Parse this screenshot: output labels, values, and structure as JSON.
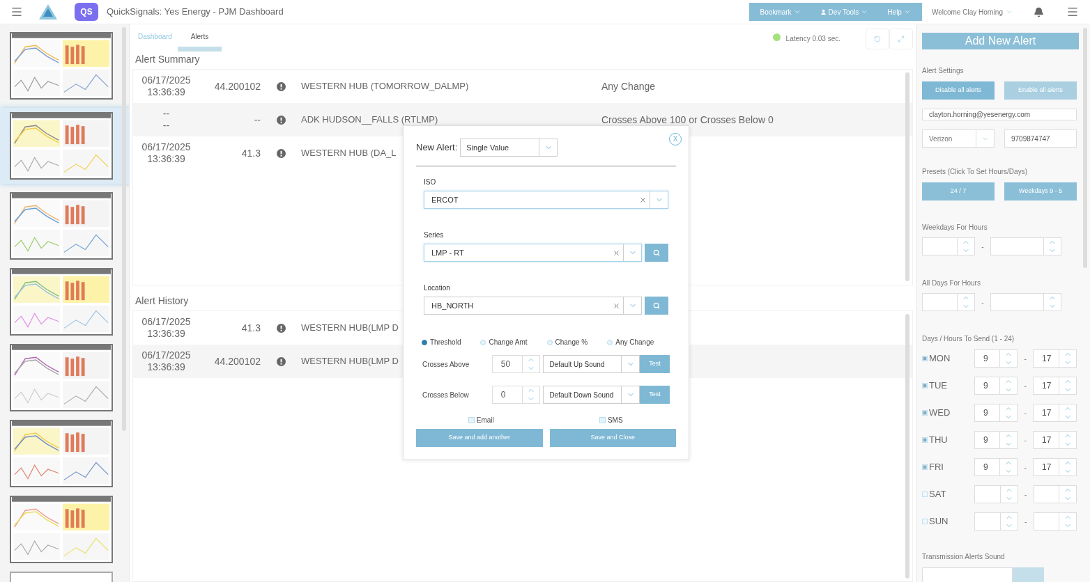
{
  "header": {
    "badge": "QS",
    "title": "QuickSignals: Yes Energy - PJM Dashboard",
    "menus": [
      {
        "label": "Bookmark",
        "kind": "plain"
      },
      {
        "label": "Dev Tools",
        "kind": "user"
      },
      {
        "label": "Help",
        "kind": "plain"
      }
    ],
    "welcome": "Welcome Clay Horning"
  },
  "sidebar": {
    "thumbnails": [
      {
        "kind": "charts",
        "selected": false
      },
      {
        "kind": "charts",
        "selected": true
      },
      {
        "kind": "charts",
        "selected": false
      },
      {
        "kind": "charts",
        "selected": false
      },
      {
        "kind": "charts",
        "selected": false
      },
      {
        "kind": "charts",
        "selected": false
      },
      {
        "kind": "charts",
        "selected": false
      },
      {
        "kind": "blank",
        "selected": false
      }
    ]
  },
  "tabs": [
    {
      "label": "Dashboard",
      "selected": false
    },
    {
      "label": "Alerts",
      "selected": true
    }
  ],
  "latency": "Latency 0.03 sec.",
  "alert_summary": {
    "title": "Alert Summary",
    "rows": [
      {
        "date": "06/17/2025",
        "time": "13:36:39",
        "value": "44.200102",
        "name": "WESTERN HUB (TOMORROW_DALMP)",
        "condition": "Any Change"
      },
      {
        "date": "--",
        "time": "--",
        "value": "--",
        "name": "ADK HUDSON__FALLS (RTLMP)",
        "condition": "Crosses Above 100 or Crosses Below 0"
      },
      {
        "date": "06/17/2025",
        "time": "13:36:39",
        "value": "41.3",
        "name": "WESTERN HUB (DA_L"
      }
    ]
  },
  "alert_history": {
    "title": "Alert History",
    "rows": [
      {
        "date": "06/17/2025",
        "time": "13:36:39",
        "value": "41.3",
        "name": "WESTERN HUB(LMP D"
      },
      {
        "date": "06/17/2025",
        "time": "13:36:39",
        "value": "44.200102",
        "name": "WESTERN HUB(LMP D"
      }
    ]
  },
  "modal": {
    "label": "New Alert:",
    "type": "Single Value",
    "close": "X",
    "fields": [
      {
        "label": "ISO",
        "value": "ERCOT",
        "search": false,
        "focused": true
      },
      {
        "label": "Series",
        "value": "LMP - RT",
        "search": true,
        "focused": true
      },
      {
        "label": "Location",
        "value": "HB_NORTH",
        "search": true,
        "focused": false
      }
    ],
    "modes": [
      {
        "label": "Threshold",
        "selected": true
      },
      {
        "label": "Change Amt",
        "selected": false
      },
      {
        "label": "Change %",
        "selected": false
      },
      {
        "label": "Any Change",
        "selected": false
      }
    ],
    "thresholds": [
      {
        "label": "Crosses Above",
        "value": "50",
        "sound": "Default Up Sound",
        "button": "Test"
      },
      {
        "label": "Crosses Below",
        "value": "0",
        "sound": "Default Down Sound",
        "button": "Test"
      }
    ],
    "notify": [
      {
        "label": "Email",
        "checked": false
      },
      {
        "label": "SMS",
        "checked": false
      }
    ],
    "buttons": [
      "Save and add another",
      "Save and Close"
    ]
  },
  "settings": {
    "add_button": "Add New Alert",
    "title": "Alert Settings",
    "toggles": [
      {
        "label": "Disable all alerts",
        "disabled": false
      },
      {
        "label": "Enable all alerts",
        "disabled": true
      }
    ],
    "email": "clayton.horning@yesenergy.com",
    "carrier": "Verizon",
    "phone": "9709874747",
    "presets_title": "Presets (Click To Set Hours/Days)",
    "presets": [
      "24 / 7",
      "Weekdays 9 - 5"
    ],
    "hour_groups": [
      {
        "title": "Weekdays For Hours",
        "separator": "-"
      },
      {
        "title": "All Days For Hours",
        "separator": "-"
      }
    ],
    "days_title": "Days / Hours To Send (1 - 24)",
    "days": [
      {
        "label": "MON",
        "checked": true,
        "from": "9",
        "to": "17",
        "separator": "-"
      },
      {
        "label": "TUE",
        "checked": true,
        "from": "9",
        "to": "17",
        "separator": "-"
      },
      {
        "label": "WED",
        "checked": true,
        "from": "9",
        "to": "17",
        "separator": "-"
      },
      {
        "label": "THU",
        "checked": true,
        "from": "9",
        "to": "17",
        "separator": "-"
      },
      {
        "label": "FRI",
        "checked": true,
        "from": "9",
        "to": "17",
        "separator": "-"
      },
      {
        "label": "SAT",
        "checked": false,
        "separator": "-"
      },
      {
        "label": "SUN",
        "checked": false,
        "separator": "-"
      }
    ],
    "sound_title": "Transmission Alerts Sound"
  }
}
